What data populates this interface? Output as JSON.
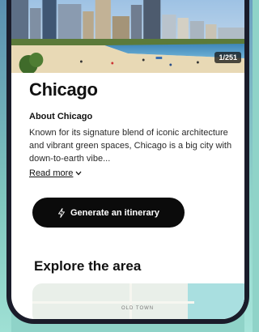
{
  "hero": {
    "photo_counter": "1/251"
  },
  "city": {
    "title": "Chicago",
    "about_heading": "About Chicago",
    "about_text": "Known for its signature blend of iconic architecture and vibrant green spaces, Chicago is a big city with down-to-earth vibe...",
    "read_more_label": "Read more"
  },
  "actions": {
    "generate_label": "Generate an itinerary"
  },
  "explore": {
    "title": "Explore the area",
    "map_label": "OLD TOWN"
  },
  "colors": {
    "button_bg": "#0b0b0b",
    "phone_frame": "#1a1c2a",
    "backdrop": "#8fd3c8"
  },
  "icons": {
    "bolt": "lightning-bolt-icon",
    "chevron": "chevron-down-icon"
  }
}
